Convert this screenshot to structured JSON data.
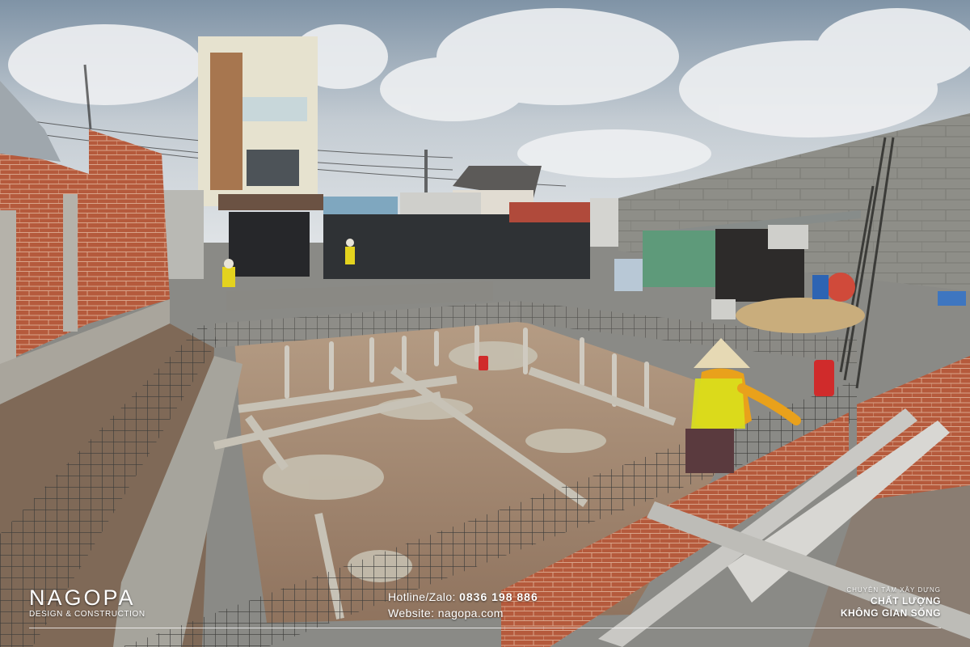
{
  "brand": {
    "name": "NAGOPA",
    "tagline": "DESIGN & CONSTRUCTION"
  },
  "contact": {
    "hotline_label": "Hotline/Zalo:",
    "hotline_value": "0836 198 886",
    "website_label": "Website:",
    "website_value": "nagopa.com"
  },
  "slogan": {
    "top": "CHUYÊN TÂM XÂY DỰNG",
    "line1": "CHẤT LƯỢNG",
    "line2": "KHÔNG GIAN SỐNG"
  },
  "colors": {
    "sky": "#c9d3dc",
    "brick": "#b9583a",
    "soil": "#a98b72",
    "concrete": "#9a9a96",
    "wall_gray": "#8f8f8a",
    "shed_green": "#5e9a7a",
    "worker_vest": "#e8d21a",
    "worker_shirt": "#e9a11b"
  }
}
